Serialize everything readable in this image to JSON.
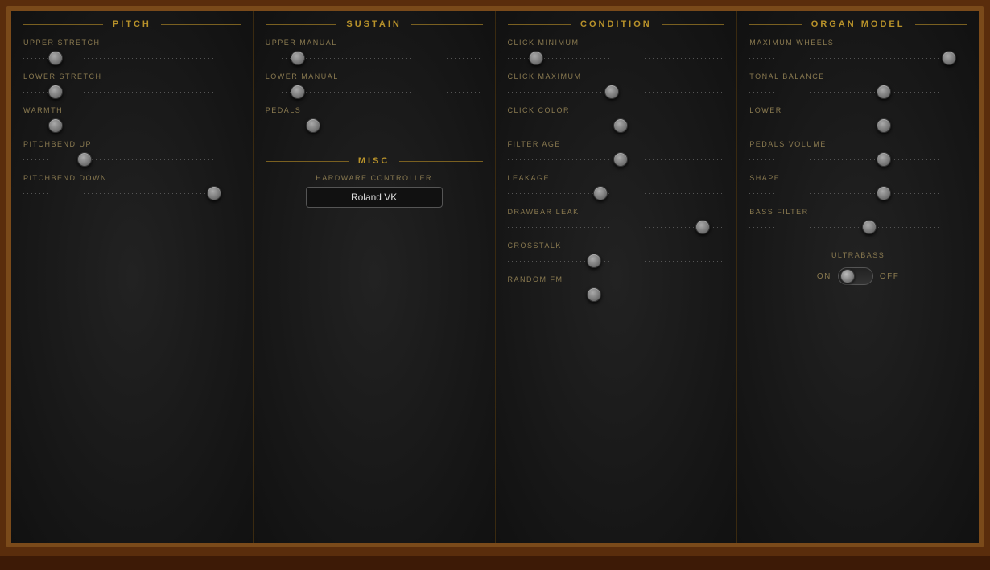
{
  "panels": {
    "pitch": {
      "title": "PITCH",
      "sliders": [
        {
          "label": "UPPER STRETCH",
          "position": 15
        },
        {
          "label": "LOWER STRETCH",
          "position": 15
        },
        {
          "label": "WARMTH",
          "position": 15
        },
        {
          "label": "PITCHBEND UP",
          "position": 28
        },
        {
          "label": "PITCHBEND DOWN",
          "position": 88
        }
      ]
    },
    "sustain": {
      "title": "SUSTAIN",
      "sliders": [
        {
          "label": "UPPER MANUAL",
          "position": 15
        },
        {
          "label": "LOWER MANUAL",
          "position": 15
        },
        {
          "label": "PEDALS",
          "position": 22
        }
      ],
      "misc_title": "MISC",
      "hw_label": "HARDWARE CONTROLLER",
      "hw_value": "Roland VK"
    },
    "condition": {
      "title": "CONDITION",
      "sliders": [
        {
          "label": "CLICK MINIMUM",
          "position": 13
        },
        {
          "label": "CLICK MAXIMUM",
          "position": 48
        },
        {
          "label": "CLICK COLOR",
          "position": 52
        },
        {
          "label": "FILTER AGE",
          "position": 52
        },
        {
          "label": "LEAKAGE",
          "position": 43
        },
        {
          "label": "DRAWBAR LEAK",
          "position": 90
        },
        {
          "label": "CROSSTALK",
          "position": 40
        },
        {
          "label": "RANDOM FM",
          "position": 40
        }
      ]
    },
    "organ_model": {
      "title": "ORGAN MODEL",
      "sliders": [
        {
          "label": "MAXIMUM WHEELS",
          "position": 92
        },
        {
          "label": "TONAL BALANCE",
          "position": 62
        },
        {
          "label": "LOWER",
          "position": 62
        },
        {
          "label": "PEDALS VOLUME",
          "position": 62
        },
        {
          "label": "SHAPE",
          "position": 62
        },
        {
          "label": "BASS FILTER",
          "position": 55
        }
      ],
      "ultrabass_label": "ULTRABASS",
      "on_label": "ON",
      "off_label": "OFF"
    }
  }
}
